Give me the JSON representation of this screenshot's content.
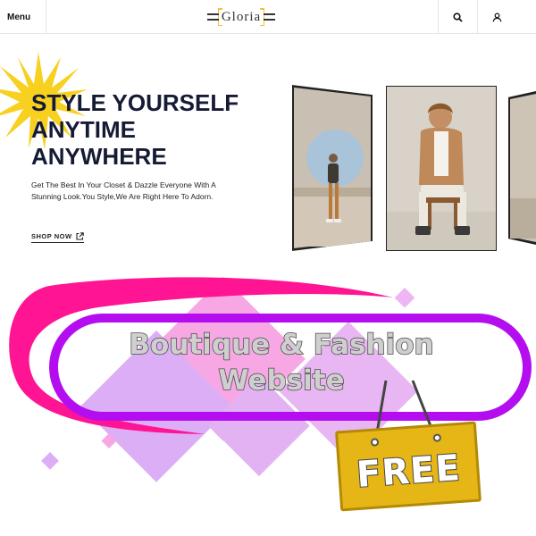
{
  "header": {
    "menu_label": "Menu",
    "logo_text": "Gloria",
    "icons": [
      "search-icon",
      "user-icon"
    ]
  },
  "hero": {
    "title_lines": [
      "STYLE YOURSELF",
      "ANYTIME",
      "ANYWHERE"
    ],
    "description": "Get The Best In Your Closet & Dazzle Everyone With A Stunning Look.You Style,We Are Right Here To Adorn.",
    "shop_now_label": "SHOP NOW"
  },
  "promo": {
    "title_lines": [
      "Boutique & Fashion",
      "Website"
    ],
    "tag_label": "FREE"
  },
  "colors": {
    "navy": "#151a35",
    "sun_yellow": "#f7d020",
    "logo_gold": "#f2c230",
    "magenta": "#ff1493",
    "purple": "#b40ef0",
    "diamond_pink": "#f7a8e4",
    "diamond_lilac": "#dcaef5",
    "tag_gold": "#e5b616"
  }
}
